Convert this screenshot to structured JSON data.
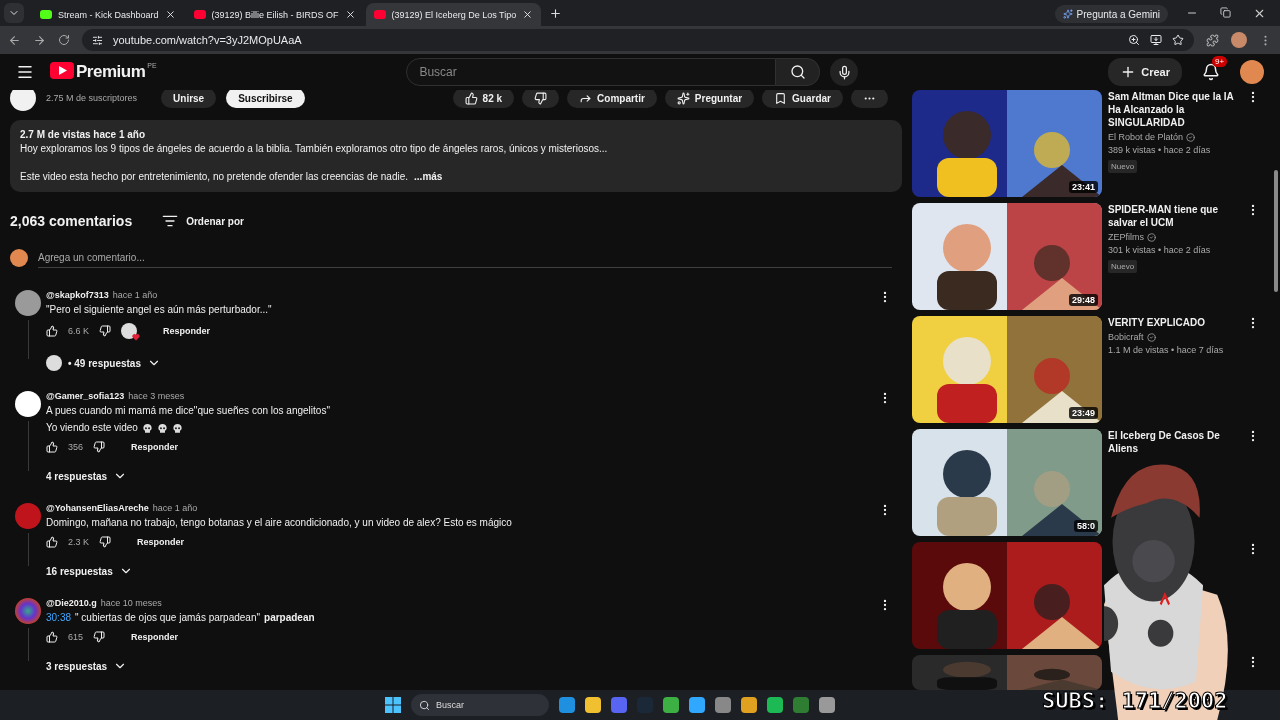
{
  "browser": {
    "tabs": [
      {
        "title": "Stream - Kick Dashboard",
        "kind": "kick",
        "selected": false
      },
      {
        "title": "(39129) Billie Eilish - BIRDS OF",
        "kind": "youtube",
        "selected": false
      },
      {
        "title": "(39129) El Iceberg De Los Tipo",
        "kind": "youtube",
        "selected": true
      }
    ],
    "url": "youtube.com/watch?v=3yJ2MOpUAaA",
    "gemini": "Pregunta a Gemini"
  },
  "header": {
    "logo": "Premium",
    "region": "PE",
    "search_placeholder": "Buscar",
    "create": "Crear",
    "notifications": "9+"
  },
  "video": {
    "subscribers": "2.75 M de suscriptores",
    "join": "Unirse",
    "subscribe": "Suscribirse",
    "likes": "82 k",
    "actions": [
      {
        "kind": "share",
        "label": "Compartir"
      },
      {
        "kind": "ask",
        "label": "Preguntar"
      },
      {
        "kind": "save",
        "label": "Guardar"
      }
    ],
    "description": {
      "stats": "2.7 M de vistas  hace 1 año",
      "lines": [
        "Hoy exploramos los 9 tipos de ángeles de acuerdo a la biblia. También exploramos otro tipo de ángeles raros, únicos y misteriosos...",
        "Este video esta hecho por entretenimiento, no pretende ofender las creencias de nadie."
      ],
      "more": "...más"
    }
  },
  "comments": {
    "count": "2,063 comentarios",
    "sort": "Ordenar por",
    "placeholder": "Agrega un comentario...",
    "items": [
      {
        "author": "@skapkof7313",
        "time": "hace 1 año",
        "lines": [
          [
            {
              "kind": "text",
              "text": "\"Pero el siguiente angel es aún más perturbador...\""
            }
          ]
        ],
        "likes": "6.6 K",
        "creator_heart": true,
        "reply": "Responder",
        "replies": "• 49 respuestas",
        "creator_replied": true
      },
      {
        "author": "@Gamer_sofia123",
        "time": "hace 3 meses",
        "lines": [
          [
            {
              "kind": "text",
              "text": "A pues cuando mi mamá me dice\"que sueñes con los angelitos\""
            }
          ],
          [
            {
              "kind": "text",
              "text": "Yo viendo este video"
            },
            {
              "kind": "skull"
            },
            {
              "kind": "skull"
            },
            {
              "kind": "skull"
            }
          ]
        ],
        "likes": "356",
        "creator_heart": false,
        "reply": "Responder",
        "replies": "4 respuestas",
        "creator_replied": false
      },
      {
        "author": "@YohansenEliasAreche",
        "time": "hace 1 año",
        "lines": [
          [
            {
              "kind": "text",
              "text": "Domingo, mañana no trabajo, tengo botanas y el aire acondicionado, y un video de alex? Esto es mágico"
            }
          ]
        ],
        "likes": "2.3 K",
        "creator_heart": false,
        "reply": "Responder",
        "replies": "16 respuestas",
        "creator_replied": false
      },
      {
        "author": "@Die2010.g",
        "time": "hace 10 meses",
        "lines": [
          [
            {
              "kind": "link",
              "text": "30:38"
            },
            {
              "kind": "text",
              "text": "\" cubiertas de ojos que jamás parpadean\""
            },
            {
              "kind": "bold",
              "text": "parpadean"
            }
          ]
        ],
        "likes": "615",
        "creator_heart": false,
        "reply": "Responder",
        "replies": "3 respuestas",
        "creator_replied": false
      }
    ]
  },
  "related": [
    {
      "kind": "video",
      "title": "Sam Altman Dice que la IA Ha Alcanzado la SINGULARIDAD",
      "channel": "El Robot de Platón",
      "verified": true,
      "stats": "389 k vistas • hace 2 días",
      "badge": "Nuevo",
      "duration": "23:41"
    },
    {
      "kind": "video",
      "title": "SPIDER-MAN tiene que salvar el UCM",
      "channel": "ZEPfilms",
      "verified": true,
      "stats": "301 k vistas • hace 2 días",
      "badge": "Nuevo",
      "duration": "29:48"
    },
    {
      "kind": "video",
      "title": "VERITY EXPLICADO",
      "channel": "Bobicraft",
      "verified": true,
      "stats": "1.1 M de vistas • hace 7 días",
      "duration": "23:49"
    },
    {
      "kind": "video",
      "title": "El Iceberg De Casos De Aliens",
      "duration": "58:0"
    },
    {
      "kind": "video"
    },
    {
      "kind": "video"
    }
  ],
  "overlay": {
    "subs": "SUBS: 171/2002"
  },
  "taskbar": {
    "search": "Buscar"
  }
}
